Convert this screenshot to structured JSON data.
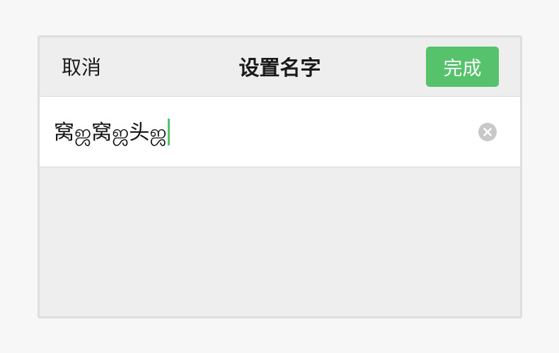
{
  "header": {
    "cancel_label": "取消",
    "title": "设置名字",
    "done_label": "完成"
  },
  "name_field": {
    "value": "窝ஜ窝ஜ头ஜ",
    "clear_icon": "clear-circle-icon"
  },
  "colors": {
    "accent": "#56c26b",
    "caret": "#56c26b",
    "background": "#eeeeee"
  }
}
